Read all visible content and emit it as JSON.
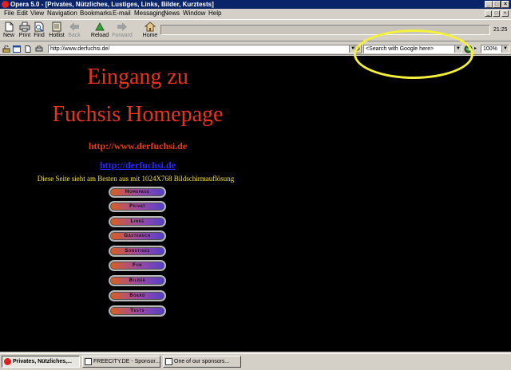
{
  "window": {
    "title": "Opera 5.0 - [Privates, Nützliches, Lustiges, Links, Bilder, Kurztests]"
  },
  "menu": [
    "File",
    "Edit",
    "View",
    "Navigation",
    "Bookmarks",
    "E-mail",
    "Messaging",
    "News",
    "Window",
    "Help"
  ],
  "toolbar": {
    "new": "New",
    "print": "Print",
    "find": "Find",
    "hotlist": "Hotlist",
    "back": "Back",
    "reload": "Reload",
    "forward": "Forward",
    "home": "Home",
    "clock": "21:25"
  },
  "address": {
    "url": "http://www.derfuchsi.de/",
    "search_placeholder": "<Search with Google here>",
    "zoom": "100%"
  },
  "page": {
    "heading1": "Eingang zu",
    "heading2": "Fuchsis Homepage",
    "url_text": "http://www.derfuchsi.de",
    "link": "http://derfuchsi.de",
    "notice": "Diese Seite sieht am Besten aus mit 1024X768 Bildschirmauflösung",
    "nav": [
      "Homepage",
      "Privat",
      "Links",
      "Gästebuch",
      "Sonstiges",
      "Fun",
      "Bilder",
      "Board",
      "Tests"
    ]
  },
  "taskbar": {
    "items": [
      "Privates, Nützliches,...",
      "FREECITY.DE - Sponsor...",
      "One of our sponsors..."
    ]
  },
  "colors": {
    "heading": "#e8341c",
    "url_text": "#e83a14",
    "link": "#2828ff",
    "notice": "#f0e040",
    "annotation": "#f5f03c"
  }
}
